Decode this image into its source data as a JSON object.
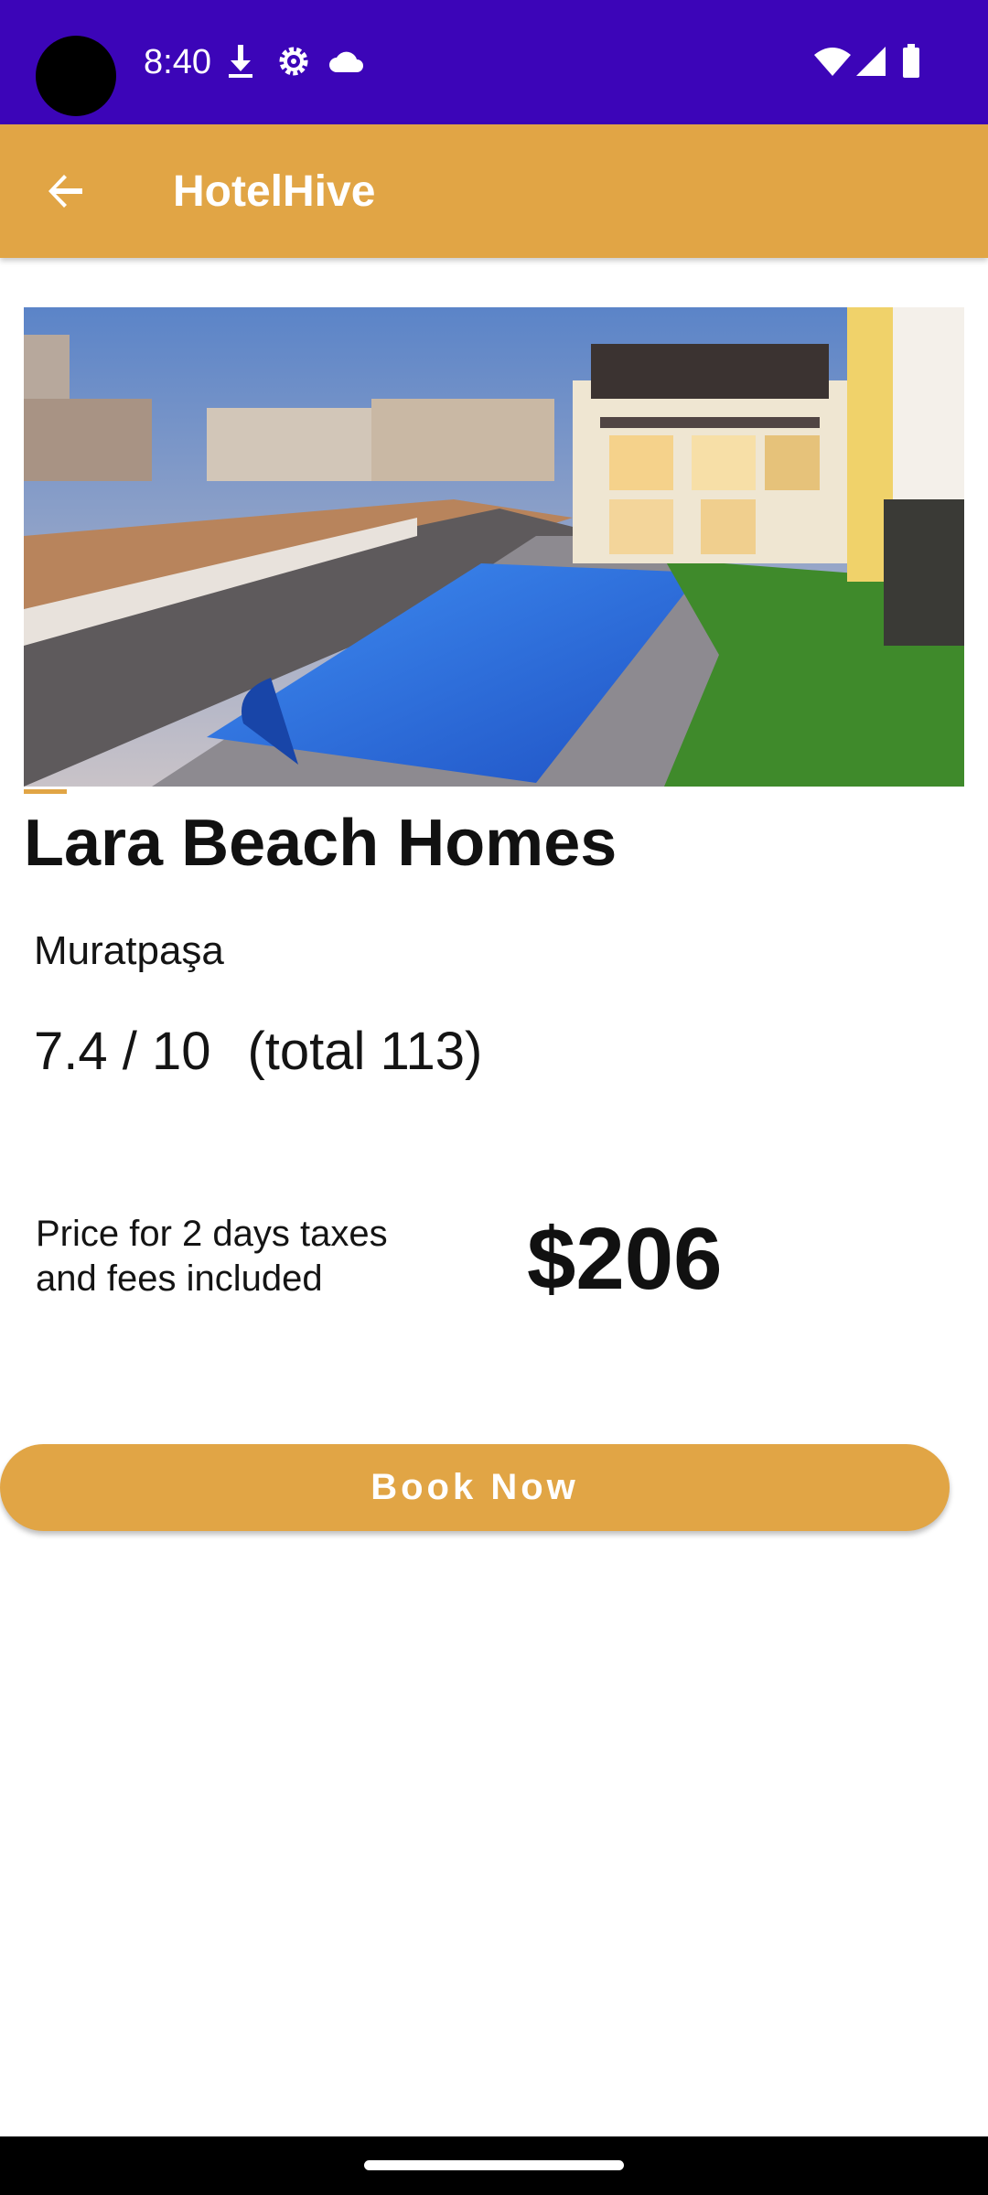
{
  "status_bar": {
    "time": "8:40",
    "left_icons": [
      "download-icon",
      "settings-gear-icon",
      "cloud-icon"
    ],
    "right_icons": [
      "wifi-icon",
      "cell-signal-icon",
      "battery-icon"
    ],
    "background": "#3C05B8"
  },
  "app_bar": {
    "title": "HotelHive",
    "back_icon": "arrow-back-icon",
    "background": "#E1A545"
  },
  "hotel": {
    "image": "hotel-pool-photo",
    "name": "Lara Beach Homes",
    "location": "Muratpaşa",
    "rating": "7.4 / 10",
    "total": "(total 113)"
  },
  "price": {
    "label": "Price for 2 days taxes and fees included",
    "value": "$206"
  },
  "actions": {
    "book_label": "Book Now"
  },
  "colors": {
    "accent": "#E1A545",
    "status_bar": "#3C05B8",
    "text": "#141414"
  }
}
